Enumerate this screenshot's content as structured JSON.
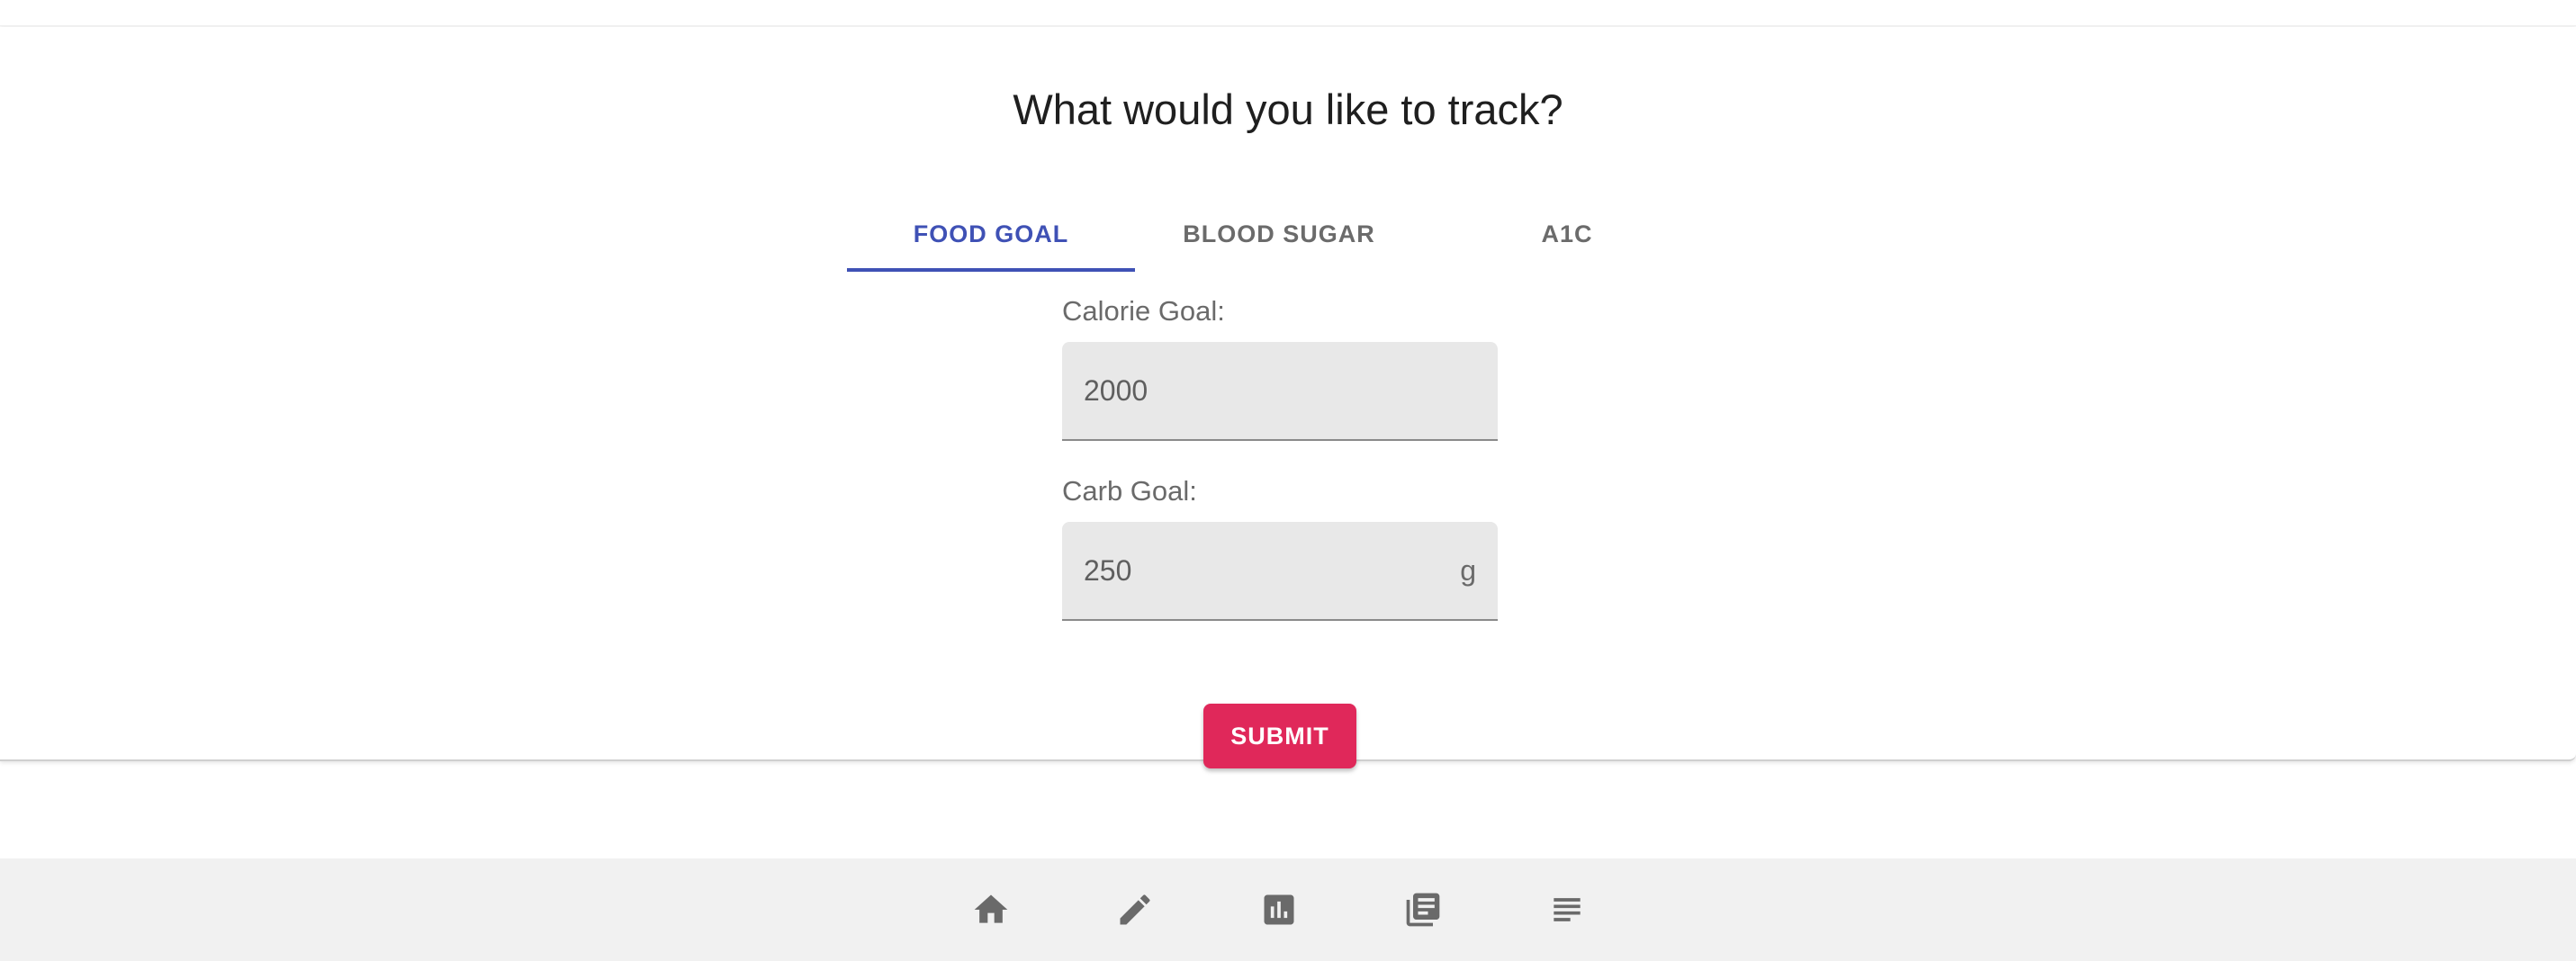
{
  "page": {
    "title": "What would you like to track?"
  },
  "tabs": [
    {
      "label": "FOOD GOAL",
      "active": true
    },
    {
      "label": "BLOOD SUGAR",
      "active": false
    },
    {
      "label": "A1C",
      "active": false
    }
  ],
  "form": {
    "calorie_label": "Calorie Goal:",
    "calorie_value": "2000",
    "carb_label": "Carb Goal:",
    "carb_value": "250",
    "carb_unit": "g",
    "submit_label": "SUBMIT"
  },
  "bottom_nav": {
    "items": [
      "home-icon",
      "edit-icon",
      "chart-icon",
      "library-icon",
      "notes-icon"
    ]
  },
  "colors": {
    "accent": "#3f51b5",
    "submit": "#e0285a",
    "nav_bg": "#f1f1f1",
    "field_bg": "#e8e8e8"
  }
}
